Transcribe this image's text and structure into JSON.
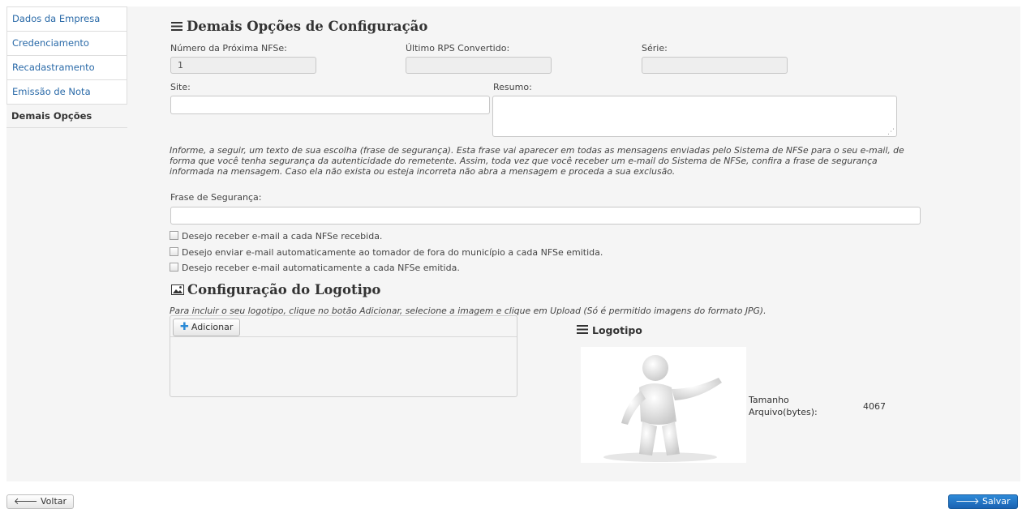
{
  "tabs": [
    {
      "label": "Dados da Empresa"
    },
    {
      "label": "Credenciamento"
    },
    {
      "label": "Recadastramento"
    },
    {
      "label": "Emissão de Nota"
    },
    {
      "label": "Demais Opções"
    }
  ],
  "section": {
    "title": "Demais Opções de Configuração",
    "numero_label": "Número da Próxima NFSe:",
    "numero_value": "1",
    "ultimo_rps_label": "Último RPS Convertido:",
    "ultimo_rps_value": "",
    "serie_label": "Série:",
    "serie_value": "",
    "site_label": "Site:",
    "site_value": "",
    "resumo_label": "Resumo:",
    "resumo_value": "",
    "info_text": "Informe, a seguir, um texto de sua escolha (frase de segurança). Esta frase vai aparecer em todas as mensagens enviadas pelo Sistema de NFSe para o seu e-mail, de forma que você tenha segurança da autenticidade do remetente. Assim, toda vez que você receber um e-mail do Sistema de NFSe, confira a frase de segurança informada na mensagem. Caso ela não exista ou esteja incorreta não abra a mensagem e proceda a sua exclusão.",
    "frase_label": "Frase de Segurança:",
    "frase_value": "",
    "checkboxes": [
      {
        "label": "Desejo receber e-mail a cada NFSe recebida.",
        "checked": false
      },
      {
        "label": "Desejo enviar e-mail automaticamente ao tomador de fora do município a cada NFSe emitida.",
        "checked": false
      },
      {
        "label": "Desejo receber e-mail automaticamente a cada NFSe emitida.",
        "checked": false
      }
    ]
  },
  "logo_section": {
    "title": "Configuração do Logotipo",
    "instructions": "Para incluir o seu logotipo, clique no botão Adicionar, selecione a imagem e clique em Upload (Só é permitido imagens do formato JPG).",
    "add_button": "Adicionar",
    "preview_title": "Logotipo",
    "size_label": "Tamanho Arquivo(bytes):",
    "size_value": "4067"
  },
  "footer": {
    "back_button": "Voltar",
    "save_button": "Salvar"
  },
  "colors": {
    "link": "#2a6aa8",
    "primary": "#1a62b2",
    "panel_bg": "#f5f5f5"
  }
}
